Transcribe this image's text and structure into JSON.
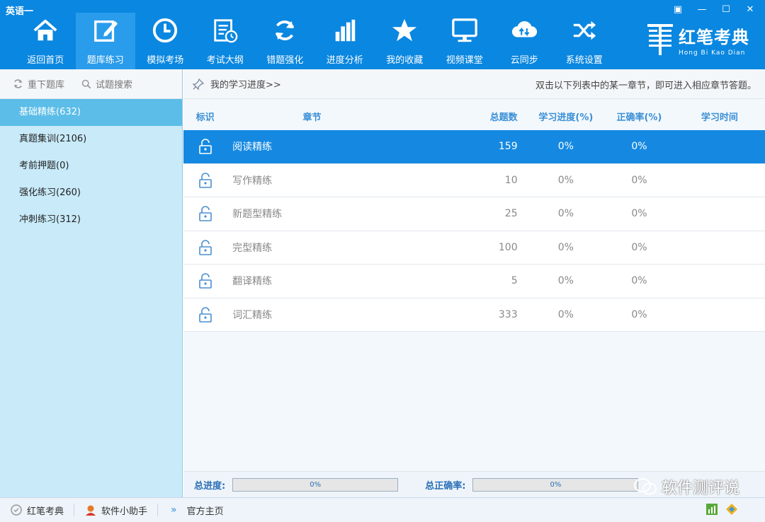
{
  "window": {
    "title": "英语一"
  },
  "toolbar": {
    "items": [
      {
        "label": "返回首页",
        "icon": "home-icon"
      },
      {
        "label": "题库练习",
        "icon": "edit-icon"
      },
      {
        "label": "模拟考场",
        "icon": "clock-icon"
      },
      {
        "label": "考试大纲",
        "icon": "calendar-icon"
      },
      {
        "label": "错题强化",
        "icon": "refresh-icon"
      },
      {
        "label": "进度分析",
        "icon": "bar-chart-icon"
      },
      {
        "label": "我的收藏",
        "icon": "star-icon"
      },
      {
        "label": "视频课堂",
        "icon": "monitor-icon"
      },
      {
        "label": "云同步",
        "icon": "cloud-sync-icon"
      },
      {
        "label": "系统设置",
        "icon": "shuffle-icon"
      }
    ],
    "active_index": 1
  },
  "brand": {
    "name": "红笔考典",
    "pinyin": "Hong Bi Kao Dian"
  },
  "sidebar": {
    "actions": {
      "redownload": "重下题库",
      "search": "试题搜索"
    },
    "items": [
      {
        "label": "基础精练(632)"
      },
      {
        "label": "真题集训(2106)"
      },
      {
        "label": "考前押题(0)"
      },
      {
        "label": "强化练习(260)"
      },
      {
        "label": "冲刺练习(312)"
      }
    ]
  },
  "main": {
    "progress_link": "我的学习进度>>",
    "hint": "双击以下列表中的某一章节，即可进入相应章节答题。",
    "headers": {
      "mark": "标识",
      "chapter": "章节",
      "total": "总题数",
      "progress": "学习进度(%)",
      "accuracy": "正确率(%)",
      "time": "学习时间"
    },
    "rows": [
      {
        "name": "阅读精练",
        "total": "159",
        "progress": "0%",
        "accuracy": "0%",
        "time": ""
      },
      {
        "name": "写作精练",
        "total": "10",
        "progress": "0%",
        "accuracy": "0%",
        "time": ""
      },
      {
        "name": "新题型精练",
        "total": "25",
        "progress": "0%",
        "accuracy": "0%",
        "time": ""
      },
      {
        "name": "完型精练",
        "total": "100",
        "progress": "0%",
        "accuracy": "0%",
        "time": ""
      },
      {
        "name": "翻译精练",
        "total": "5",
        "progress": "0%",
        "accuracy": "0%",
        "time": ""
      },
      {
        "name": "词汇精练",
        "total": "333",
        "progress": "0%",
        "accuracy": "0%",
        "time": ""
      }
    ],
    "summary": {
      "progress_label": "总进度:",
      "progress_value": "0%",
      "progress_fraction": 0,
      "accuracy_label": "总正确率:",
      "accuracy_value": "0%",
      "accuracy_fraction": 0
    }
  },
  "statusbar": {
    "item1": "红笔考典",
    "item2": "软件小助手",
    "item3": "官方主页"
  },
  "watermark": {
    "text": "软件测评说"
  },
  "colors": {
    "toolbar_bg": "#0a87e0",
    "active_row": "#1589e2",
    "sidebar_bg": "#c8eaf9",
    "sidebar_active": "#5bbde8",
    "header_text": "#3a8fd6"
  }
}
